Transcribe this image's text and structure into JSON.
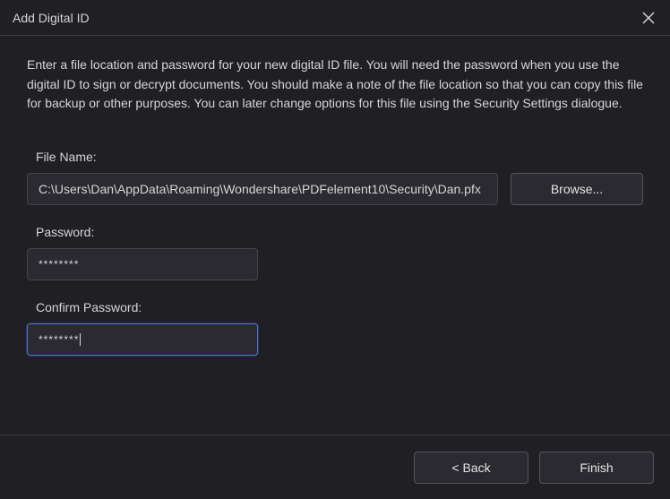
{
  "window": {
    "title": "Add Digital ID"
  },
  "description": "Enter a file location and password for your new digital ID file. You will need the password when you use the digital ID to sign or decrypt documents. You should make a note of the file location so that you can copy this file for backup or other purposes. You can later change options for this file using the Security Settings dialogue.",
  "form": {
    "file_name_label": "File Name:",
    "file_name_value": "C:\\Users\\Dan\\AppData\\Roaming\\Wondershare\\PDFelement10\\Security\\Dan.pfx",
    "browse_label": "Browse...",
    "password_label": "Password:",
    "password_value": "********",
    "confirm_password_label": "Confirm Password:",
    "confirm_password_value": "********"
  },
  "footer": {
    "back_label": "< Back",
    "finish_label": "Finish"
  }
}
